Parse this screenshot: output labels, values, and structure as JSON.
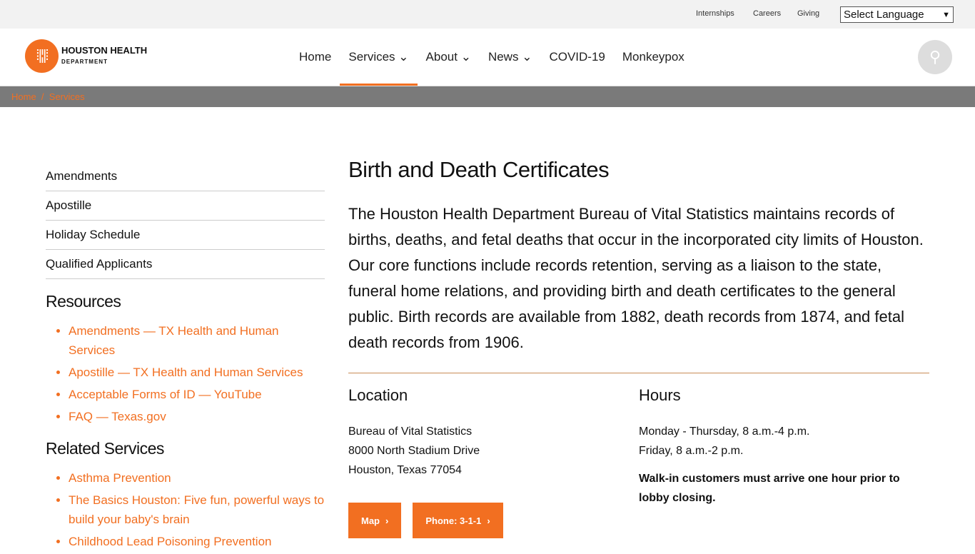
{
  "utility": {
    "links": [
      "Internships",
      "Careers",
      "Giving"
    ],
    "language": "Select Language"
  },
  "logo": {
    "name": "HOUSTON HEALTH",
    "sub": "DEPARTMENT"
  },
  "nav": [
    {
      "label": "Home"
    },
    {
      "label": "Services",
      "caret": "⌄"
    },
    {
      "label": "About",
      "caret": "⌄"
    },
    {
      "label": "News",
      "caret": "⌄"
    },
    {
      "label": "COVID-19"
    },
    {
      "label": "Monkeypox"
    }
  ],
  "breadcrumb": {
    "home": "Home",
    "sep": "/",
    "current": "Services"
  },
  "sidebar": {
    "items": [
      "Amendments",
      "Apostille",
      "Holiday Schedule",
      "Qualified Applicants"
    ],
    "resources_title": "Resources",
    "resources": [
      "Amendments — TX Health and Human Services",
      "Apostille — TX Health and Human Services",
      "Acceptable Forms of ID — YouTube",
      "FAQ — Texas.gov"
    ],
    "related_title": "Related Services",
    "related": [
      "Asthma Prevention",
      "The Basics Houston: Five fun, powerful ways to build your baby's brain",
      "Childhood Lead Poisoning Prevention"
    ]
  },
  "main": {
    "title": "Birth and Death Certificates",
    "lead": "The Houston Health Department Bureau of Vital Statistics maintains records of births, deaths, and fetal deaths that occur in the incorporated city limits of Houston. Our core functions include records retention, serving as a liaison to the state, funeral home relations, and providing birth and death certificates to the general public. Birth records are available from 1882, death records from 1874, and fetal death records from 1906.",
    "location": {
      "title": "Location",
      "lines": [
        "Bureau of Vital Statistics",
        "8000 North Stadium Drive",
        "Houston, Texas 77054"
      ],
      "map": "Map",
      "phone": "Phone: 3-1-1"
    },
    "hours": {
      "title": "Hours",
      "lines": [
        "Monday - Thursday, 8 a.m.-4 p.m.",
        "Friday, 8 a.m.-2 p.m."
      ],
      "note": "Walk-in customers must arrive one hour prior to lobby closing."
    }
  },
  "colors": {
    "accent": "#f26f21",
    "breadcrumb_bg": "#7a7a7a"
  }
}
